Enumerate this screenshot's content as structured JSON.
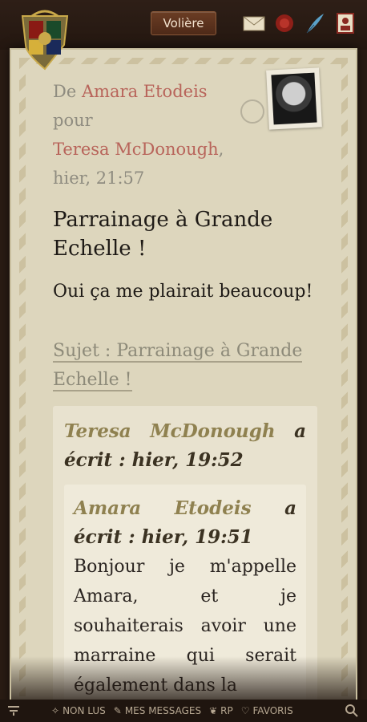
{
  "header": {
    "voliere_label": "Volière"
  },
  "letter": {
    "from_prefix": "De",
    "from_name": "Amara Etodeis",
    "to_prefix": "pour",
    "to_name": "Teresa McDonough",
    "to_suffix": ",",
    "timestamp": "hier, 21:57",
    "title": "Parrainage à Grande Echelle !",
    "body": "Oui ça me plairait beaucoup!",
    "subject": "Sujet : Parrainage à Grande Echelle !",
    "quote": {
      "author": "Teresa McDonough",
      "wrote": "a écrit : hier, 19:52",
      "inner": {
        "author": "Amara Etodeis",
        "wrote": "a écrit : hier, 19:51",
        "text": "Bonjour je m'appelle Amara, et je souhaiterais avoir une marraine qui serait également dans la"
      }
    }
  },
  "bottom_nav": {
    "items": [
      {
        "label": "NON LUS"
      },
      {
        "label": "MES MESSAGES"
      },
      {
        "label": "RP"
      },
      {
        "label": "FAVORIS"
      }
    ]
  },
  "colors": {
    "parchment": "#ddd6bd",
    "name_link": "#b8645a",
    "quote_author": "#8f8150"
  }
}
